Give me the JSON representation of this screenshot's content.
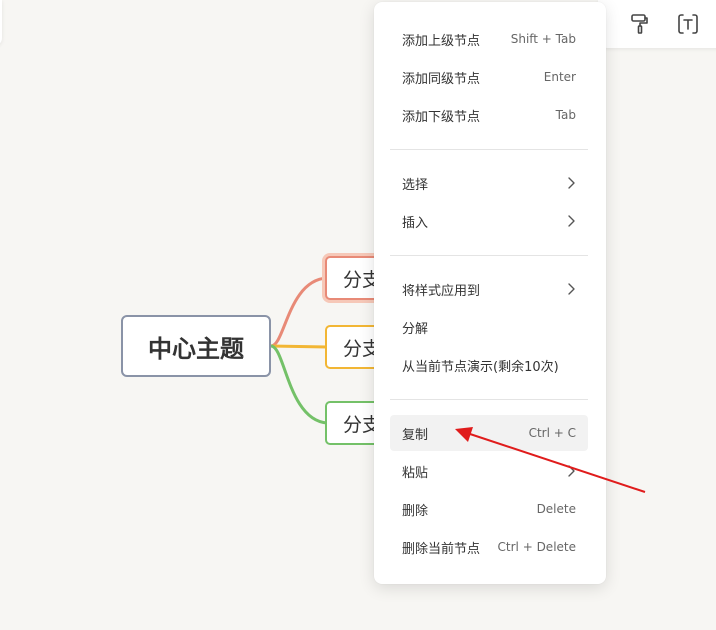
{
  "toolbar": {
    "icons": [
      "paint-roller-icon",
      "text-frame-icon"
    ]
  },
  "mindmap": {
    "root": {
      "label": "中心主题"
    },
    "branches": [
      {
        "label": "分支",
        "color": "#e88a77"
      },
      {
        "label": "分支",
        "color": "#f2b634"
      },
      {
        "label": "分支",
        "color": "#74c168"
      }
    ]
  },
  "menu": {
    "items": [
      {
        "label": "添加上级节点",
        "shortcut": "Shift + Tab"
      },
      {
        "label": "添加同级节点",
        "shortcut": "Enter"
      },
      {
        "label": "添加下级节点",
        "shortcut": "Tab"
      },
      {
        "label": "选择",
        "shortcut": ""
      },
      {
        "label": "插入",
        "shortcut": ""
      },
      {
        "label": "将样式应用到",
        "shortcut": ""
      },
      {
        "label": "分解",
        "shortcut": ""
      },
      {
        "label": "从当前节点演示(剩余10次)",
        "shortcut": ""
      },
      {
        "label": "复制",
        "shortcut": "Ctrl + C"
      },
      {
        "label": "粘贴",
        "shortcut": ""
      },
      {
        "label": "删除",
        "shortcut": "Delete"
      },
      {
        "label": "删除当前节点",
        "shortcut": "Ctrl + Delete"
      }
    ]
  },
  "colors": {
    "annotation_arrow": "#e01c1c",
    "hover_background": "#f2f2f2"
  }
}
